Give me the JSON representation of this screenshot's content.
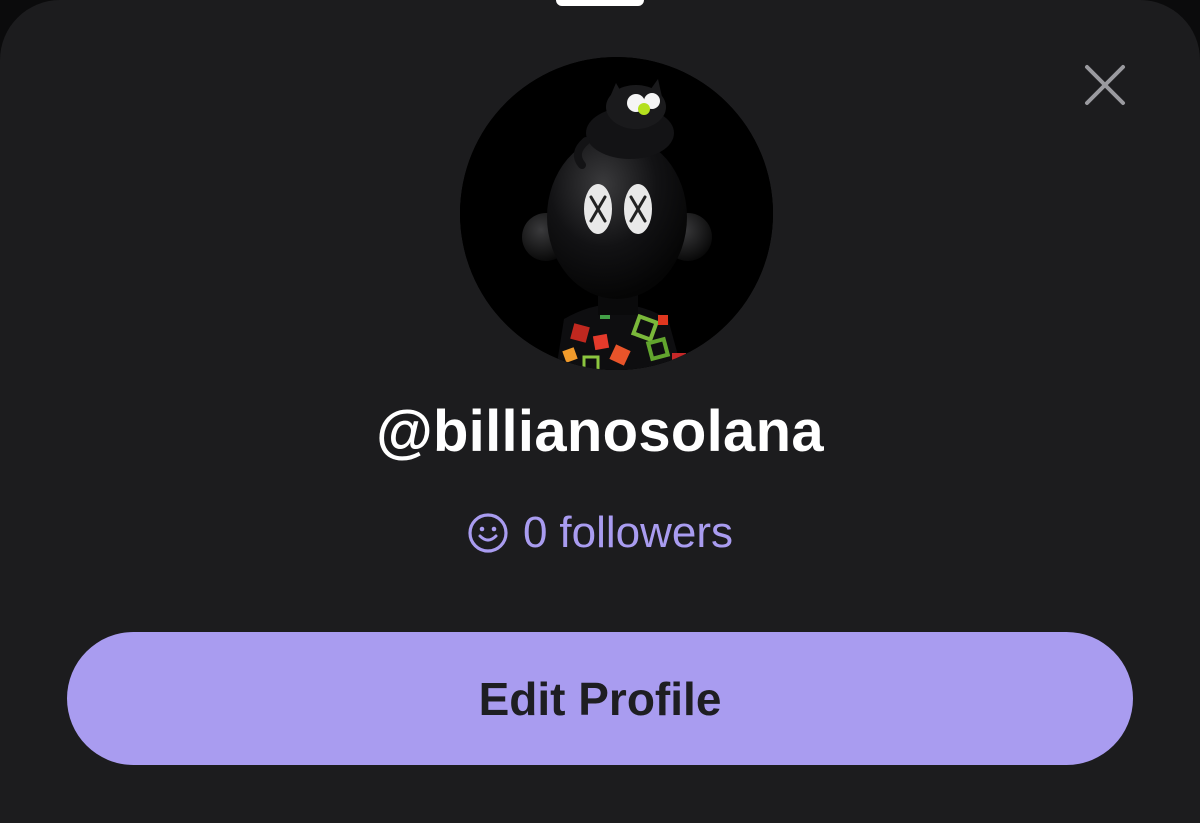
{
  "sheet": {
    "close_icon": "close-icon",
    "avatar_icon": "nft-character-avatar"
  },
  "profile": {
    "username": "@billianosolana",
    "followers_count": "0",
    "followers_label": "followers",
    "followers_icon": "smiley-face-icon"
  },
  "actions": {
    "edit_profile_label": "Edit Profile"
  },
  "colors": {
    "background": "#1c1c1e",
    "accent": "#a99cf0",
    "text": "#ffffff",
    "button_text": "#1e1e22"
  }
}
